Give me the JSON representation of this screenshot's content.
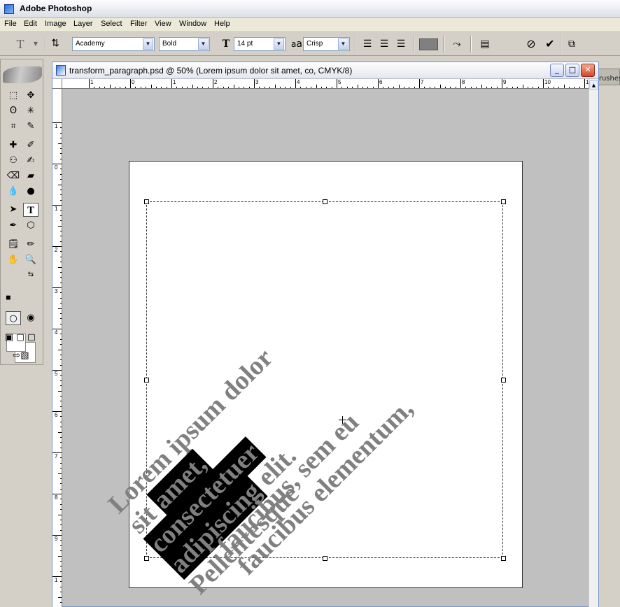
{
  "app": {
    "title": "Adobe Photoshop"
  },
  "menu": [
    {
      "label": "File"
    },
    {
      "label": "Edit"
    },
    {
      "label": "Image"
    },
    {
      "label": "Layer"
    },
    {
      "label": "Select"
    },
    {
      "label": "Filter"
    },
    {
      "label": "View"
    },
    {
      "label": "Window"
    },
    {
      "label": "Help"
    }
  ],
  "options": {
    "font_family": "Academy",
    "font_style": "Bold",
    "font_size": "14 pt",
    "antialias_glyph": "a",
    "antialias_glyph2": "a",
    "antialias": "Crisp",
    "text_color": "#808080",
    "brushes_tab": "Brushes"
  },
  "document": {
    "title": "transform_paragraph.psd @ 50% (Lorem ipsum dolor sit amet, co, CMYK/8)"
  },
  "ruler": {
    "h_labels": [
      "1",
      "0",
      "1",
      "2",
      "3",
      "4",
      "5",
      "6",
      "7",
      "8",
      "9",
      "10",
      "1"
    ],
    "v_labels": [
      "1",
      "0",
      "1",
      "2",
      "3",
      "4",
      "5",
      "6",
      "7",
      "8",
      "9",
      "1"
    ]
  },
  "canvas_text": {
    "line1_a": "Lorem ipsum dolor",
    "line2_a": "sit ",
    "line2_hl": "amet,",
    "line3_hl": "consectetuer",
    "line4_hl": "adipiscing",
    "line4_b": " elit.",
    "line5_a": "Pellentesque",
    "line6_a": "faucibus, sem eu",
    "line7_a": "faucibus elementum,"
  },
  "colors": {
    "selection_highlight": "#000000",
    "text": "#808080",
    "canvas_bg": "#c0c0c0"
  }
}
